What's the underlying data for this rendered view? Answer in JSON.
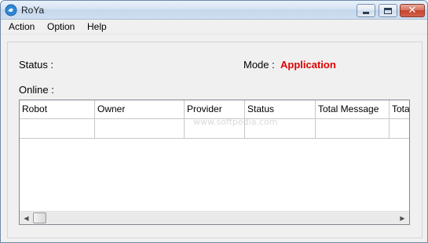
{
  "window": {
    "title": "RoYa"
  },
  "menu": {
    "items": [
      "Action",
      "Option",
      "Help"
    ]
  },
  "status": {
    "label": "Status :",
    "value": ""
  },
  "mode": {
    "label": "Mode :",
    "value": "Application",
    "value_color": "#e00000"
  },
  "online": {
    "label": "Online :"
  },
  "table": {
    "columns": [
      "Robot",
      "Owner",
      "Provider",
      "Status",
      "Total Message",
      "Total"
    ],
    "rows": []
  },
  "watermark": "www.softpedia.com",
  "icons": {
    "app": "roya-app-icon",
    "minimize": "minimize-icon",
    "maximize": "maximize-icon",
    "close": "close-icon",
    "scroll_left": "scroll-left-arrow-icon",
    "scroll_right": "scroll-right-arrow-icon"
  }
}
